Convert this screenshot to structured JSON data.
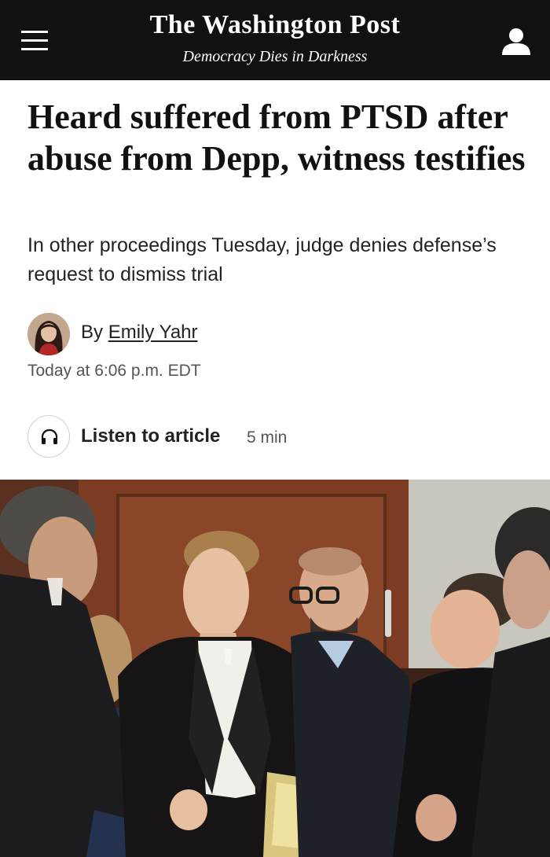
{
  "header": {
    "logo": "The Washington Post",
    "tagline": "Democracy Dies in Darkness",
    "menu_icon": "hamburger-menu-icon",
    "account_icon": "user-account-icon",
    "background_color": "#111111"
  },
  "article": {
    "headline": "Heard suffered from PTSD after abuse from Depp, witness testifies",
    "subheadline": "In other proceedings Tuesday, judge denies defense’s request to dismiss trial",
    "byline_prefix": "By",
    "author": "Emily Yahr",
    "timestamp": "Today at 6:06 p.m. EDT"
  },
  "listen": {
    "icon": "headphones-icon",
    "label": "Listen to article",
    "duration": "5 min"
  }
}
